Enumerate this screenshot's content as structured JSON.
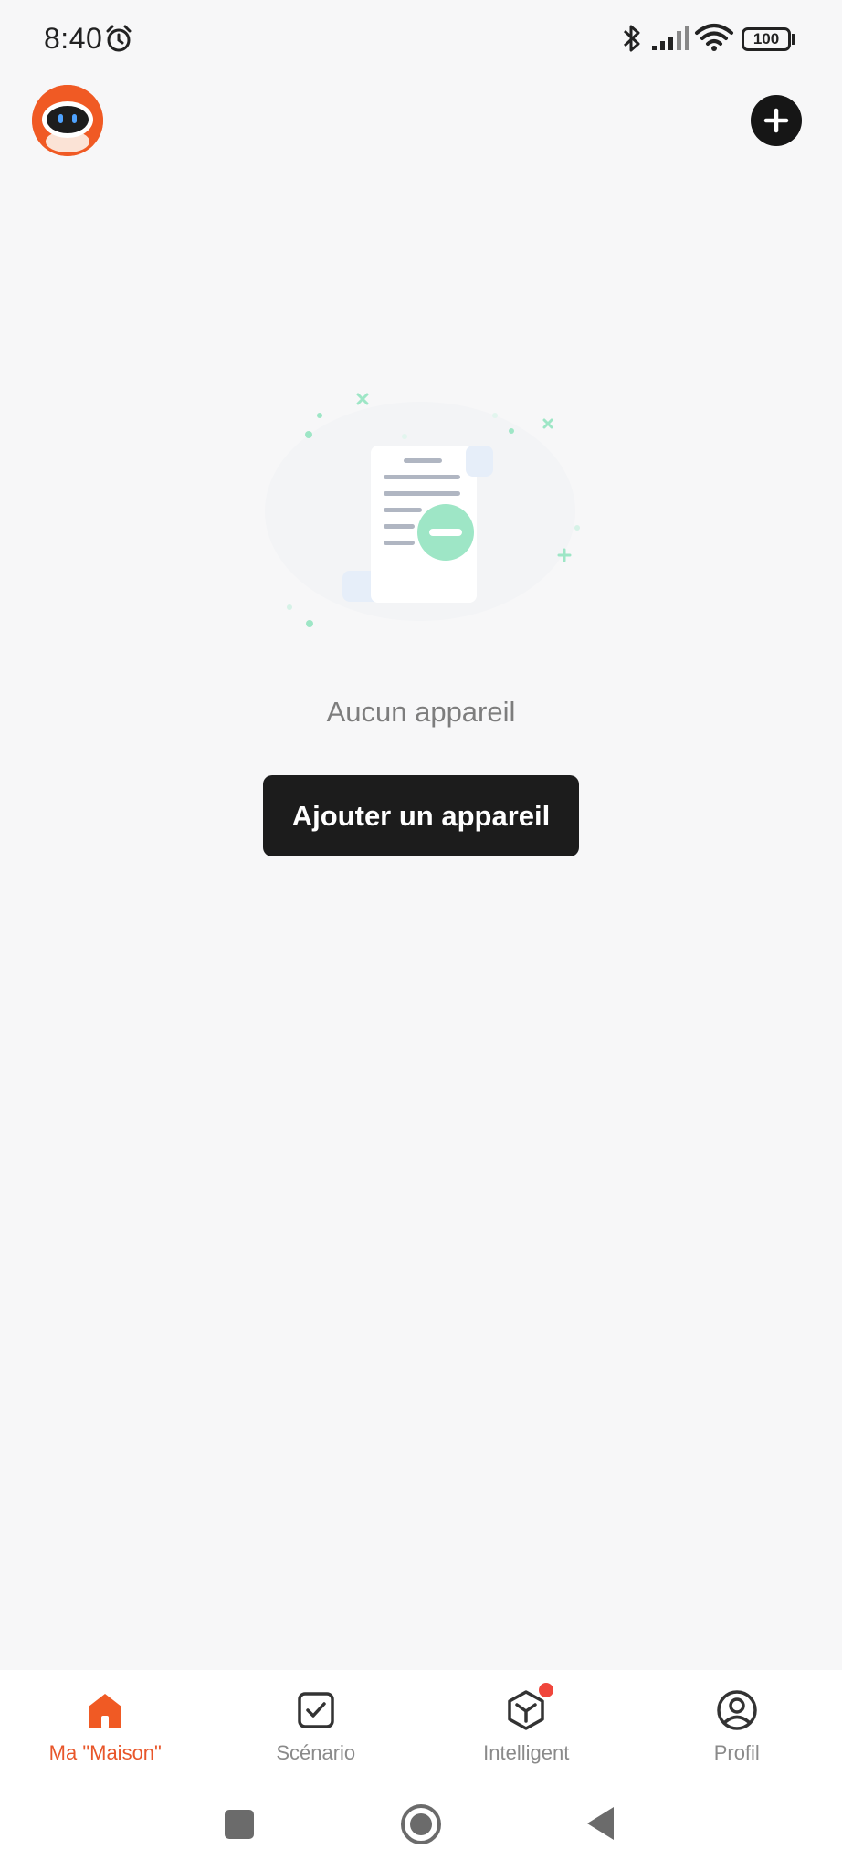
{
  "status_bar": {
    "time": "8:40",
    "battery": "100",
    "icons": [
      "alarm-icon",
      "bluetooth-icon",
      "signal-icon",
      "wifi-icon",
      "battery-icon"
    ]
  },
  "header": {
    "avatar_icon": "robot-avatar-icon",
    "add_icon": "plus-icon"
  },
  "empty_state": {
    "illustration": "empty-document-icon",
    "message": "Aucun appareil",
    "button_label": "Ajouter un appareil"
  },
  "tabs": [
    {
      "label": "Ma \"Maison\"",
      "icon": "home-icon",
      "active": true
    },
    {
      "label": "Scénario",
      "icon": "checkbox-icon",
      "active": false
    },
    {
      "label": "Intelligent",
      "icon": "cube-icon",
      "active": false,
      "badge": true
    },
    {
      "label": "Profil",
      "icon": "profile-icon",
      "active": false
    }
  ],
  "colors": {
    "accent": "#e8562a",
    "background": "#f7f7f8",
    "button_dark": "#1c1c1c",
    "illustration_green": "#9ee6c6",
    "badge_red": "#f0463c"
  }
}
